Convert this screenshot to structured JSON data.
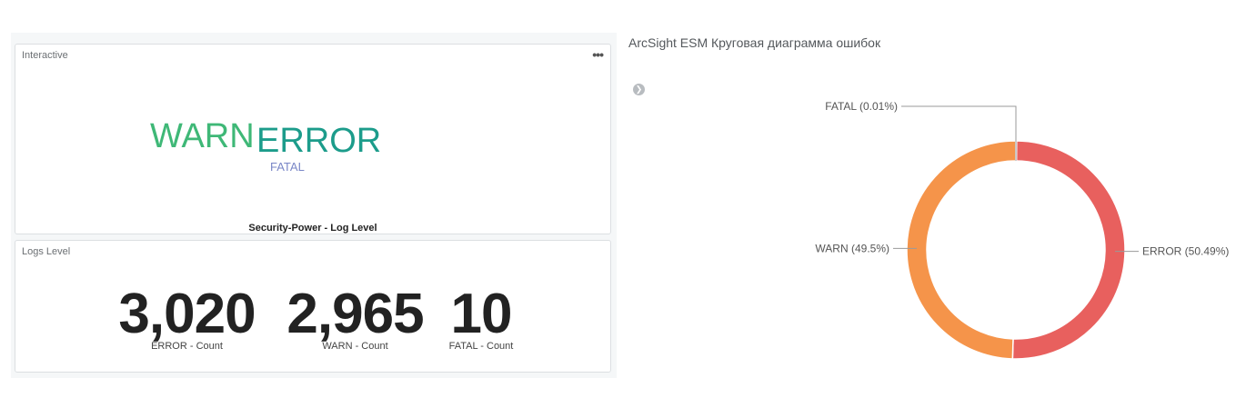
{
  "panels": {
    "interactive": {
      "title": "Interactive",
      "menu_icon": "more-dots-icon",
      "cloud_words": [
        "WARN",
        "ERROR",
        "FATAL"
      ],
      "caption": "Security-Power - Log Level"
    },
    "logs_level": {
      "title": "Logs Level",
      "metrics": [
        {
          "value": "3,020",
          "label": "ERROR - Count"
        },
        {
          "value": "2,965",
          "label": "WARN - Count"
        },
        {
          "value": "10",
          "label": "FATAL - Count"
        }
      ]
    }
  },
  "chart": {
    "title": "ArcSight ESM Круговая диаграмма ошибок",
    "nav_icon": "chevron-right-circle-icon"
  },
  "chart_data": {
    "type": "pie",
    "slices": [
      {
        "name": "ERROR",
        "percent": 50.49,
        "label": "ERROR (50.49%)",
        "color": "#e8605e"
      },
      {
        "name": "WARN",
        "percent": 49.5,
        "label": "WARN (49.5%)",
        "color": "#f5944a"
      },
      {
        "name": "FATAL",
        "percent": 0.01,
        "label": "FATAL (0.01%)",
        "color": "#bfbfbf"
      }
    ],
    "donut": true
  }
}
